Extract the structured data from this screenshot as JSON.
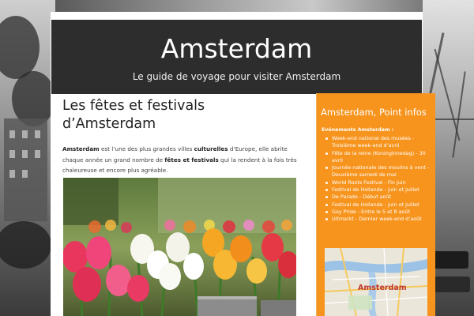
{
  "header": {
    "site_title": "Amsterdam",
    "tagline": "Le guide de voyage pour visiter Amsterdam"
  },
  "post": {
    "title": "Les fêtes et festivals d’Amsterdam",
    "intro": {
      "p1": "Amsterdam",
      "p2": " est l’une des plus grandes villes ",
      "p3": "culturelles",
      "p4": " d’Europe, elle abrite chaque année un grand nombre de ",
      "p5": "fêtes et festivals",
      "p6": " qui la rendent à la fois très chaleureuse et encore plus agréable."
    }
  },
  "sidebar": {
    "title": "Amsterdam, Point infos",
    "events_heading": "Evénements Amsterdam :",
    "events": [
      "Week-end national des musées - Troisième week-end d’avril",
      "Fête de la reine (Koninginnedag) - 30 avril",
      "Journée nationale des moulins à vent - Deuxième samedi de mai",
      "World Roots Festival - Fin juin",
      "Festival de Hollande - juin et juillet",
      "De Parade - Début août",
      "Festival de Hollande - juin et juillet",
      "Gay Pride - Entre le 5 et 8 août",
      "Uitmarkt - Dernier week-end d’août"
    ],
    "map_label": "Amsterdam"
  },
  "icons": {
    "photo": "tulips-photo",
    "map": "city-map-image"
  },
  "colors": {
    "header_bg": "#2d2d2d",
    "sidebar_bg": "#f7941d",
    "page_bg": "#ffffff"
  }
}
